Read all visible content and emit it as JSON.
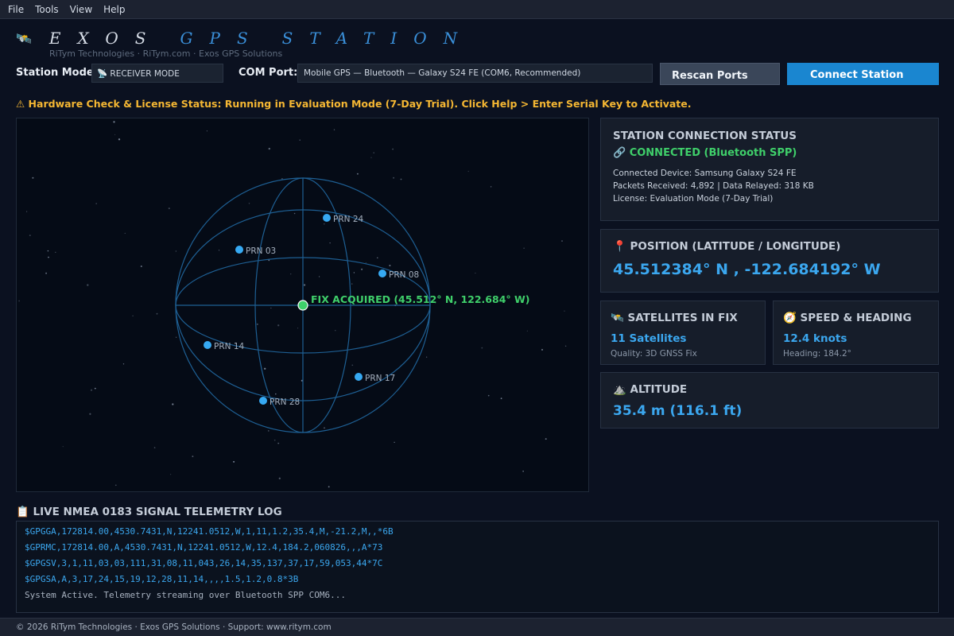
{
  "menu": {
    "items": [
      "File",
      "Tools",
      "View",
      "Help"
    ]
  },
  "header": {
    "icon_glyph": "🛰️",
    "title_part1": "EXOS",
    "title_part2": "GPS",
    "title_part3": "STATION",
    "subtitle": "RiTym Technologies  ·  RiTym.com  ·  Exos GPS Solutions"
  },
  "toolbar": {
    "mode_label": "Station Mode:",
    "mode_value": "📡 RECEIVER MODE",
    "com_label": "COM Port:",
    "com_value": "Mobile GPS — Bluetooth — Galaxy S24 FE (COM6, Recommended)",
    "rescan_label": "Rescan Ports",
    "connect_label": "Connect Station"
  },
  "warning": {
    "text": "⚠ Hardware Check & License Status: Running in Evaluation Mode (7-Day Trial). Click Help > Enter Serial Key to Activate."
  },
  "sky_view": {
    "fix_label": "FIX ACQUIRED (45.512° N, 122.684° W)",
    "satellites": [
      {
        "prn": "PRN 24",
        "label": "PRN 24"
      },
      {
        "prn": "PRN 03",
        "label": "PRN 03"
      },
      {
        "prn": "PRN 08",
        "label": "PRN 08"
      },
      {
        "prn": "PRN 14",
        "label": "PRN 14"
      },
      {
        "prn": "PRN 17",
        "label": "PRN 17"
      },
      {
        "prn": "PRN 28",
        "label": "PRN 28"
      }
    ],
    "colors": {
      "globe": "#1e5f93",
      "satellite": "#36a9f2",
      "fix": "#3fcf6a"
    }
  },
  "connection": {
    "title": "STATION CONNECTION STATUS",
    "status": "🔗 CONNECTED (Bluetooth SPP)",
    "device": "Connected Device: Samsung Galaxy S24 FE",
    "packets": "Packets Received: 4,892  |  Data Relayed: 318 KB",
    "license": "License: Evaluation Mode (7-Day Trial)"
  },
  "position": {
    "title": "📍 POSITION (LATITUDE / LONGITUDE)",
    "value": "45.512384° N , -122.684192° W"
  },
  "satellites_fix": {
    "title": "🛰️ SATELLITES IN FIX",
    "value": "11 Satellites",
    "note": "Quality: 3D GNSS Fix"
  },
  "speed": {
    "title": "🧭 SPEED & HEADING",
    "value": "12.4 knots",
    "note": "Heading: 184.2°"
  },
  "altitude": {
    "title": "⛰️ ALTITUDE",
    "value": "35.4 m (116.1 ft)"
  },
  "log": {
    "title": "📋 LIVE NMEA 0183 SIGNAL TELEMETRY LOG",
    "lines": [
      "$GPGGA,172814.00,4530.7431,N,12241.0512,W,1,11,1.2,35.4,M,-21.2,M,,*6B",
      "$GPRMC,172814.00,A,4530.7431,N,12241.0512,W,12.4,184.2,060826,,,A*73",
      "$GPGSV,3,1,11,03,03,111,31,08,11,043,26,14,35,137,37,17,59,053,44*7C",
      "$GPGSA,A,3,17,24,15,19,12,28,11,14,,,,1.5,1.2,0.8*3B",
      "System Active. Telemetry streaming over Bluetooth SPP COM6..."
    ]
  },
  "footer": {
    "text": "© 2026 RiTym Technologies  ·  Exos GPS Solutions  ·  Support: www.ritym.com"
  }
}
